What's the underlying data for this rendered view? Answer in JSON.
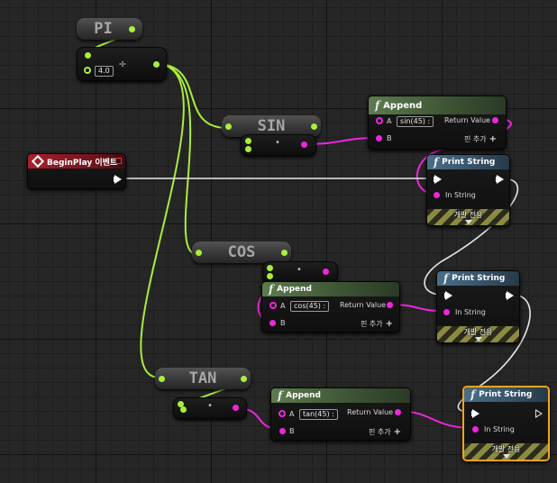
{
  "nodes": {
    "pi": {
      "label": "PI"
    },
    "divide": {
      "operator": "÷",
      "b_value": "4.0"
    },
    "sin": {
      "label": "SIN"
    },
    "cos": {
      "label": "COS"
    },
    "tan": {
      "label": "TAN"
    },
    "multiply": {
      "operator": "•"
    },
    "begin_play": {
      "title": "BeginPlay 이벤트"
    },
    "append": {
      "title": "Append",
      "pin_a": "A",
      "pin_b": "B",
      "return_value": "Return Value",
      "add_pin": "핀 추가",
      "add_icon": "+"
    },
    "append_sin_a": "sin(45) :",
    "append_cos_a": "cos(45) :",
    "append_tan_a": "tan(45) :",
    "print_string": {
      "title": "Print String",
      "in_string": "In String",
      "dev_only": "개발 전용"
    },
    "function_icon": "f"
  },
  "colors": {
    "float_pin": "#a9ee3c",
    "string_pin": "#ef26de",
    "exec_wire": "#e8e8e8",
    "selected_outline": "#f2a51a"
  }
}
